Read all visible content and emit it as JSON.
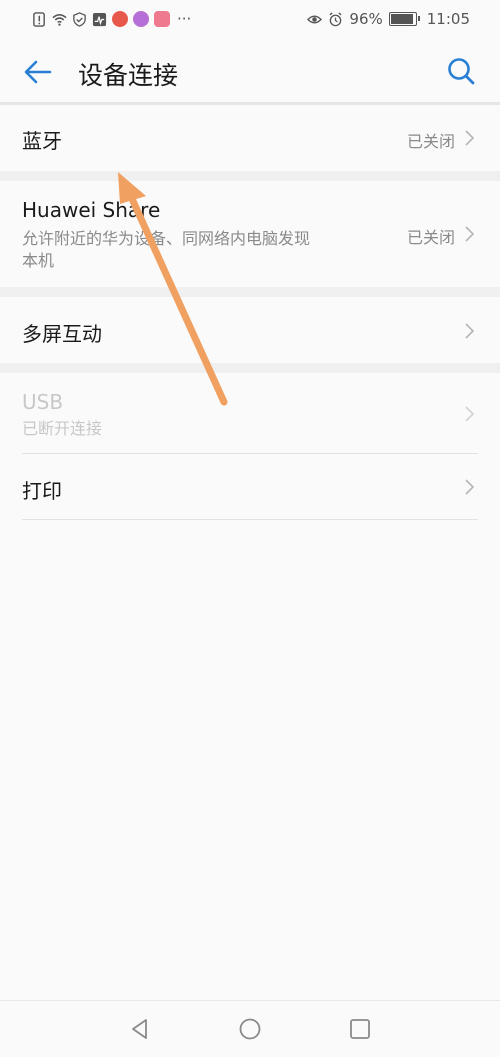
{
  "status_bar": {
    "battery": "96%",
    "time": "11:05"
  },
  "header": {
    "title": "设备连接"
  },
  "rows": [
    {
      "title": "蓝牙",
      "value": "已关闭"
    },
    {
      "title": "Huawei Share",
      "subtitle": "允许附近的华为设备、同网络内电脑发现本机",
      "value": "已关闭"
    },
    {
      "title": "多屏互动"
    },
    {
      "title": "USB",
      "subtitle": "已断开连接",
      "disabled": true
    },
    {
      "title": "打印"
    }
  ],
  "colors": {
    "accent": "#2a7fd4",
    "annotation_arrow": "#f0a060"
  }
}
